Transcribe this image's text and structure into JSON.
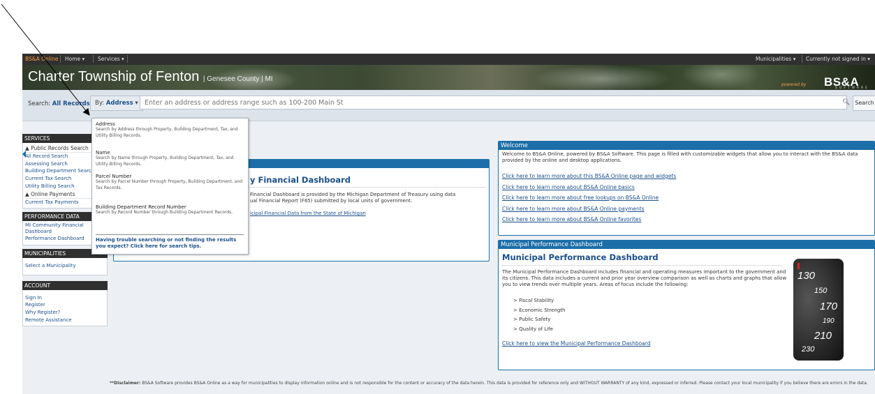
{
  "topnav": {
    "brand": "BS&A Online",
    "home": "Home ▾",
    "services": "Services ▾",
    "municipalities": "Municipalities ▾",
    "account_status": "Currently not signed in ▾"
  },
  "banner": {
    "title": "Charter Township of Fenton",
    "subtitle": "| Genesee County | MI",
    "powered_by": "powered by",
    "logo": "BS&A",
    "logo_sub": "SOFTWARE"
  },
  "search": {
    "label": "Search:",
    "scope": "All Records",
    "by_label": "By:",
    "by_value": "Address",
    "placeholder": "Enter an address or address range such as 100-200 Main St",
    "button": "Search"
  },
  "dropdown": {
    "items": [
      {
        "name": "Address",
        "desc": "Search by Address through Property, Building Department, Tax, and Utility Billing Records."
      },
      {
        "name": "Name",
        "desc": "Search by Name through Property, Building Department, Tax, and Utility Billing Records."
      },
      {
        "name": "Parcel Number",
        "desc": "Search by Parcel Number through Property, Building Department, and Tax Records."
      },
      {
        "name": "Building Department Record Number",
        "desc": "Search by Record Number through Building Department Records."
      }
    ],
    "help": "Having trouble searching or not finding the results you expect? Click here for search tips."
  },
  "sidebar": {
    "services_head": "SERVICES",
    "public_records": "Public Records Search",
    "links": [
      "All Record Search",
      "Assessing Search",
      "Building Department Search",
      "Current Tax Search",
      "Utility Billing Search"
    ],
    "online_payments": "Online Payments",
    "payment_link": "Current Tax Payments",
    "performance_head": "PERFORMANCE DATA",
    "performance_links": [
      "MI Community Financial Dashboard",
      "Performance Dashboard"
    ],
    "municipalities_head": "MUNICIPALITIES",
    "select_municipality": "Select a Municipality",
    "account_head": "ACCOUNT",
    "account_links": [
      "Sign In",
      "Register",
      "Why Register?",
      "Remote Assistance"
    ]
  },
  "financial_panel": {
    "title": "y Financial Dashboard",
    "line1": "Financial Dashboard is provided by the Michigan Department of Treasury using data",
    "line2": "ual Financial Report (F65) submitted by local units of government.",
    "link": "icipal Financial Data from the State of Michigan"
  },
  "welcome_panel": {
    "head": "Welcome",
    "text": "Welcome to BS&A Online, powered by BS&A Software. This page is filled with customizable widgets that allow you to interact with the BS&A data provided by the online and desktop applications.",
    "links": [
      "Click here to learn more about this BS&A Online page and widgets",
      "Click here to learn more about BS&A Online basics",
      "Click here to learn more about free lookups on BS&A Online",
      "Click here to learn more about BS&A Online payments",
      "Click here to learn more about BS&A Online favorites"
    ]
  },
  "mpd_panel": {
    "head": "Municipal Performance Dashboard",
    "title": "Municipal Performance Dashboard",
    "text": "The Municipal Performance Dashboard includes financial and operating measures important to the government and its citizens.  This data includes a current and prior year overview comparison as well as charts and graphs that allow you to view trends over multiple years.  Areas of focus include the following:",
    "bullets": [
      "> Fiscal Stability",
      "> Economic Strength",
      "> Public Safety",
      "> Quality of Life"
    ],
    "link": "Click here to view the Municipal Performance Dashboard",
    "gauge_numbers": [
      "130",
      "150",
      "170",
      "190",
      "210",
      "230"
    ]
  },
  "disclaimer": {
    "label": "**Disclaimer:",
    "text": " BS&A Software provides BS&A Online as a way for municipalities to display information online and is not responsible for the content or accuracy of the data herein. This data is provided for reference only and WITHOUT WARRANTY of any kind, expressed or inferred. Please contact your local municipality if you believe there are errors in the data."
  },
  "colors": {
    "accent": "#1b6ea8",
    "link": "#1a4f8c",
    "nav": "#303030",
    "brand": "#ff9a3c"
  }
}
